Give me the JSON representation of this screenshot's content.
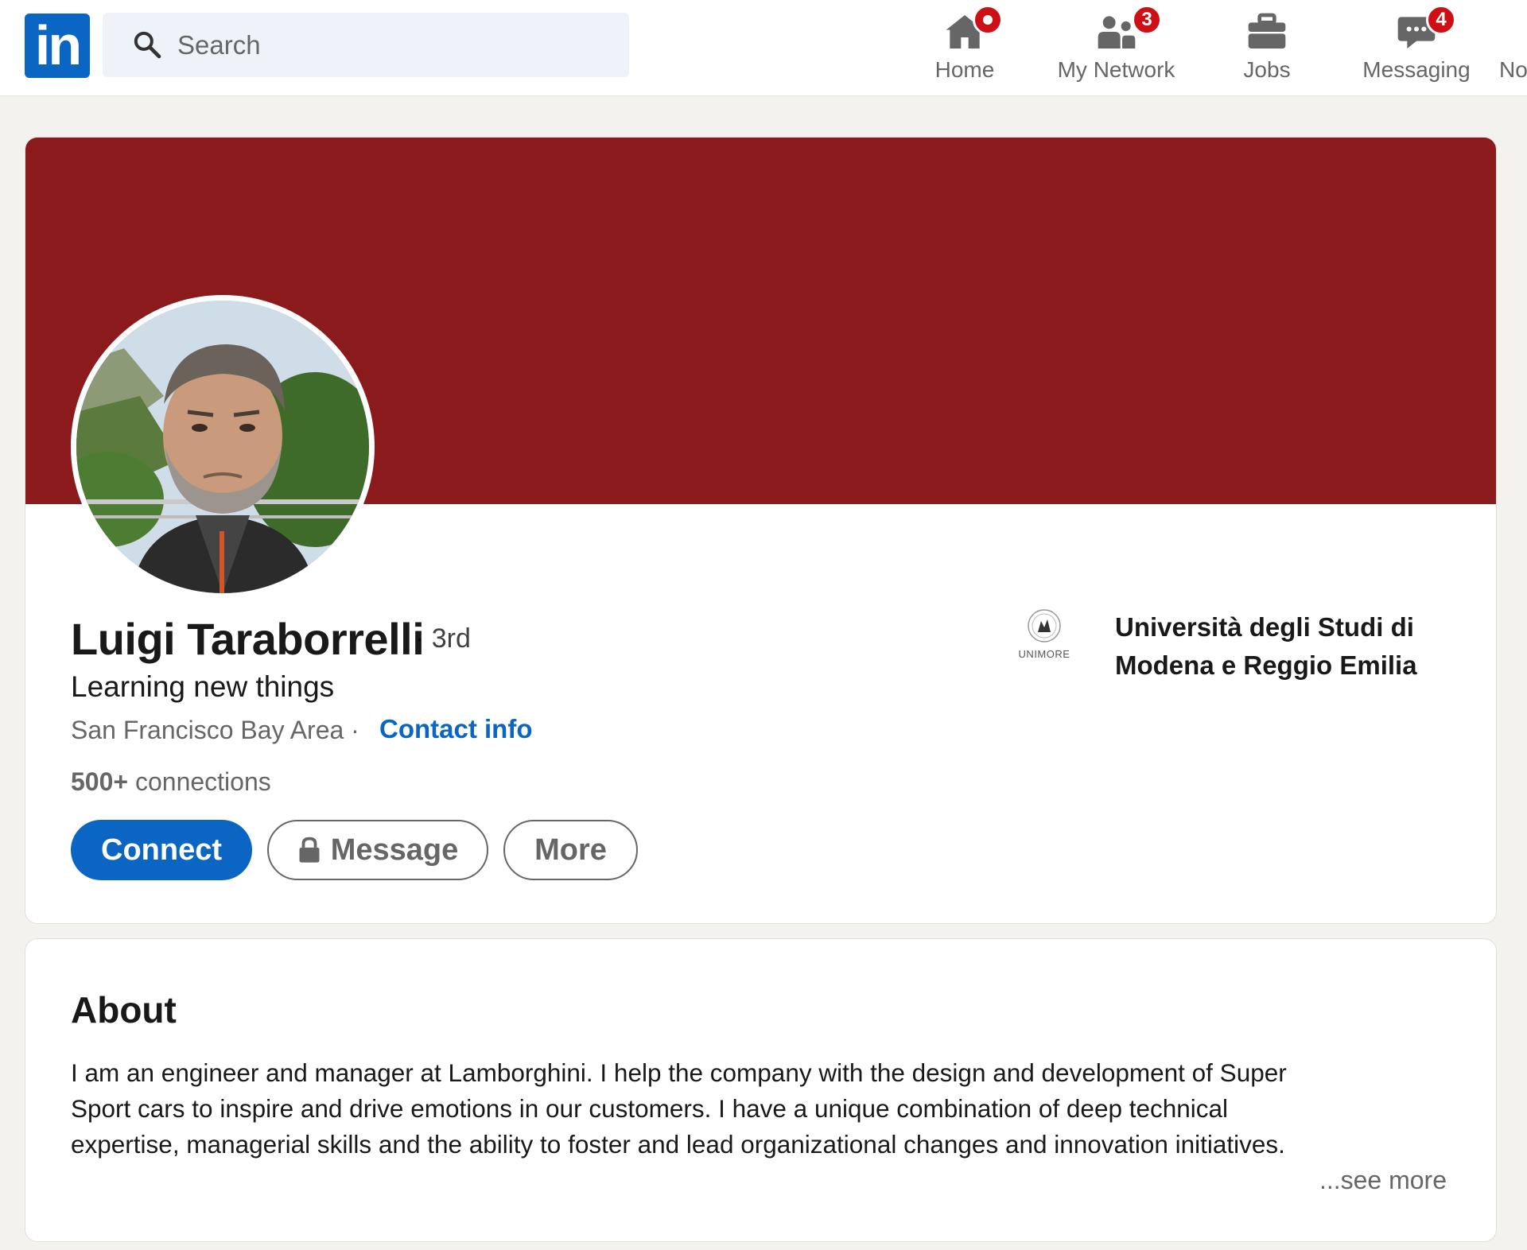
{
  "nav": {
    "logo_text": "in",
    "search_placeholder": "Search",
    "items": [
      {
        "label": "Home",
        "badge": ""
      },
      {
        "label": "My Network",
        "badge": "3"
      },
      {
        "label": "Jobs",
        "badge": ""
      },
      {
        "label": "Messaging",
        "badge": "4"
      },
      {
        "label": "No"
      }
    ]
  },
  "profile": {
    "name": "Luigi Taraborrelli",
    "degree": "· 3rd",
    "headline": "Learning new things",
    "location": "San Francisco Bay Area ·",
    "contact_info": "Contact info",
    "connections_count": "500+",
    "connections_label": "connections",
    "buttons": {
      "connect": "Connect",
      "message": "Message",
      "more": "More"
    },
    "education": {
      "logo_text": "UNIMORE",
      "name": "Università degli Studi di Modena e Reggio Emilia"
    }
  },
  "about": {
    "title": "About",
    "lines": [
      "I am an engineer and manager at Lamborghini. I help the company with the design and development of Super",
      "Sport cars to inspire and drive emotions in our customers. I have a unique combination of deep technical",
      "expertise, managerial skills and the ability to foster and lead organizational changes and innovation initiatives."
    ],
    "see_more": "...see more"
  },
  "colors": {
    "brand": "#0a66c2",
    "banner": "#8a1a1c",
    "badge": "#cc1016",
    "page_bg": "#f3f2ef"
  }
}
